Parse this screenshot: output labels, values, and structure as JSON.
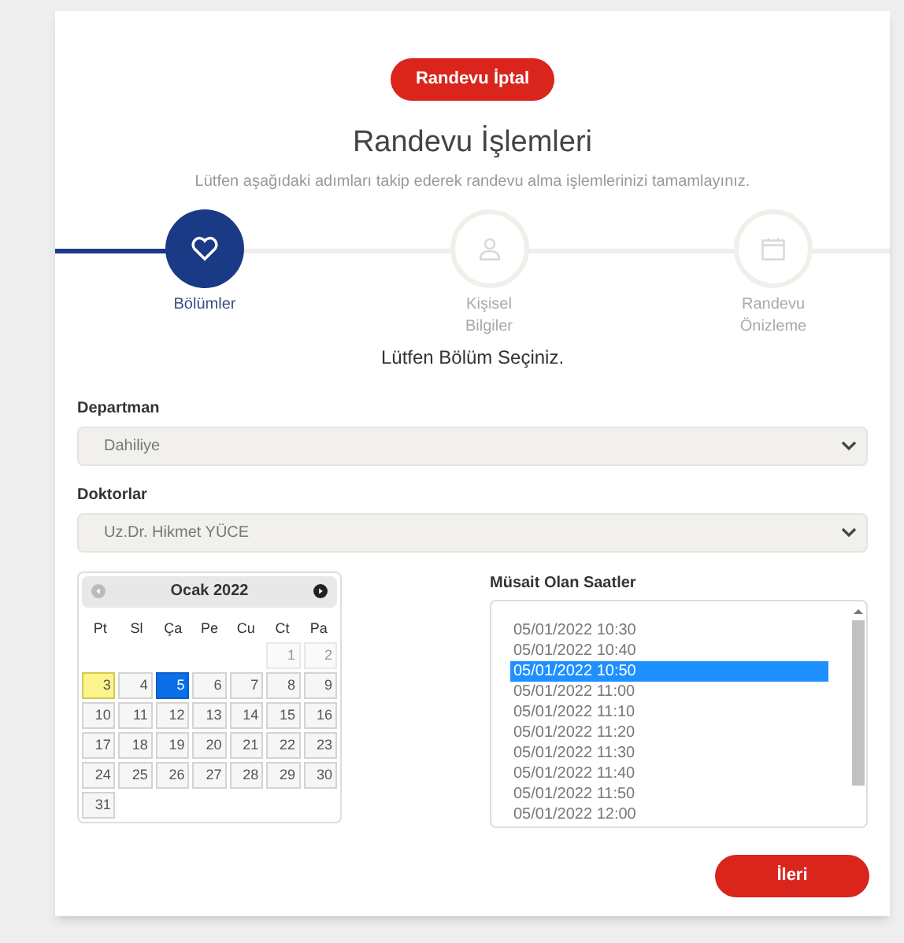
{
  "cancel_button": "Randevu İptal",
  "title": "Randevu İşlemleri",
  "subtitle": "Lütfen aşağıdaki adımları takip ederek randevu alma işlemlerinizi tamamlayınız.",
  "steps": [
    {
      "kind": "heart",
      "label": "Bölümler",
      "selected": true
    },
    {
      "kind": "person",
      "label": "Kişisel Bilgiler",
      "selected": false
    },
    {
      "kind": "calendar",
      "label": "Randevu Önizleme",
      "selected": false
    }
  ],
  "prompt": "Lütfen Bölüm Seçiniz.",
  "fields": [
    {
      "label": "Departman",
      "value": "Dahiliye"
    },
    {
      "label": "Doktorlar",
      "value": "Uz.Dr. Hikmet YÜCE"
    }
  ],
  "calendar": {
    "month": "Ocak 2022",
    "weekdays": [
      "Pt",
      "Sl",
      "Ça",
      "Pe",
      "Cu",
      "Ct",
      "Pa"
    ],
    "weeks": [
      [
        {
          "kind": "blank"
        },
        {
          "kind": "blank"
        },
        {
          "kind": "blank"
        },
        {
          "kind": "blank"
        },
        {
          "kind": "blank"
        },
        {
          "day": "1",
          "disabled": true,
          "today": false,
          "selected": false
        },
        {
          "day": "2",
          "disabled": true,
          "today": false,
          "selected": false
        }
      ],
      [
        {
          "day": "3",
          "disabled": false,
          "today": true,
          "selected": false
        },
        {
          "day": "4",
          "disabled": false,
          "today": false,
          "selected": false
        },
        {
          "day": "5",
          "disabled": false,
          "today": false,
          "selected": true
        },
        {
          "day": "6",
          "disabled": false,
          "today": false,
          "selected": false
        },
        {
          "day": "7",
          "disabled": false,
          "today": false,
          "selected": false
        },
        {
          "day": "8",
          "disabled": false,
          "today": false,
          "selected": false
        },
        {
          "day": "9",
          "disabled": false,
          "today": false,
          "selected": false
        }
      ],
      [
        {
          "day": "10",
          "disabled": false,
          "today": false,
          "selected": false
        },
        {
          "day": "11",
          "disabled": false,
          "today": false,
          "selected": false
        },
        {
          "day": "12",
          "disabled": false,
          "today": false,
          "selected": false
        },
        {
          "day": "13",
          "disabled": false,
          "today": false,
          "selected": false
        },
        {
          "day": "14",
          "disabled": false,
          "today": false,
          "selected": false
        },
        {
          "day": "15",
          "disabled": false,
          "today": false,
          "selected": false
        },
        {
          "day": "16",
          "disabled": false,
          "today": false,
          "selected": false
        }
      ],
      [
        {
          "day": "17",
          "disabled": false,
          "today": false,
          "selected": false
        },
        {
          "day": "18",
          "disabled": false,
          "today": false,
          "selected": false
        },
        {
          "day": "19",
          "disabled": false,
          "today": false,
          "selected": false
        },
        {
          "day": "20",
          "disabled": false,
          "today": false,
          "selected": false
        },
        {
          "day": "21",
          "disabled": false,
          "today": false,
          "selected": false
        },
        {
          "day": "22",
          "disabled": false,
          "today": false,
          "selected": false
        },
        {
          "day": "23",
          "disabled": false,
          "today": false,
          "selected": false
        }
      ],
      [
        {
          "day": "24",
          "disabled": false,
          "today": false,
          "selected": false
        },
        {
          "day": "25",
          "disabled": false,
          "today": false,
          "selected": false
        },
        {
          "day": "26",
          "disabled": false,
          "today": false,
          "selected": false
        },
        {
          "day": "27",
          "disabled": false,
          "today": false,
          "selected": false
        },
        {
          "day": "28",
          "disabled": false,
          "today": false,
          "selected": false
        },
        {
          "day": "29",
          "disabled": false,
          "today": false,
          "selected": false
        },
        {
          "day": "30",
          "disabled": false,
          "today": false,
          "selected": false
        }
      ],
      [
        {
          "day": "31",
          "disabled": false,
          "today": false,
          "selected": false
        }
      ]
    ]
  },
  "times": {
    "label": "Müsait Olan Saatler",
    "items": [
      {
        "text": "05/01/2022 10:30",
        "selected": false
      },
      {
        "text": "05/01/2022 10:40",
        "selected": false
      },
      {
        "text": "05/01/2022 10:50",
        "selected": true
      },
      {
        "text": "05/01/2022 11:00",
        "selected": false
      },
      {
        "text": "05/01/2022 11:10",
        "selected": false
      },
      {
        "text": "05/01/2022 11:20",
        "selected": false
      },
      {
        "text": "05/01/2022 11:30",
        "selected": false
      },
      {
        "text": "05/01/2022 11:40",
        "selected": false
      },
      {
        "text": "05/01/2022 11:50",
        "selected": false
      },
      {
        "text": "05/01/2022 12:00",
        "selected": false
      }
    ]
  },
  "next_button": "İleri"
}
